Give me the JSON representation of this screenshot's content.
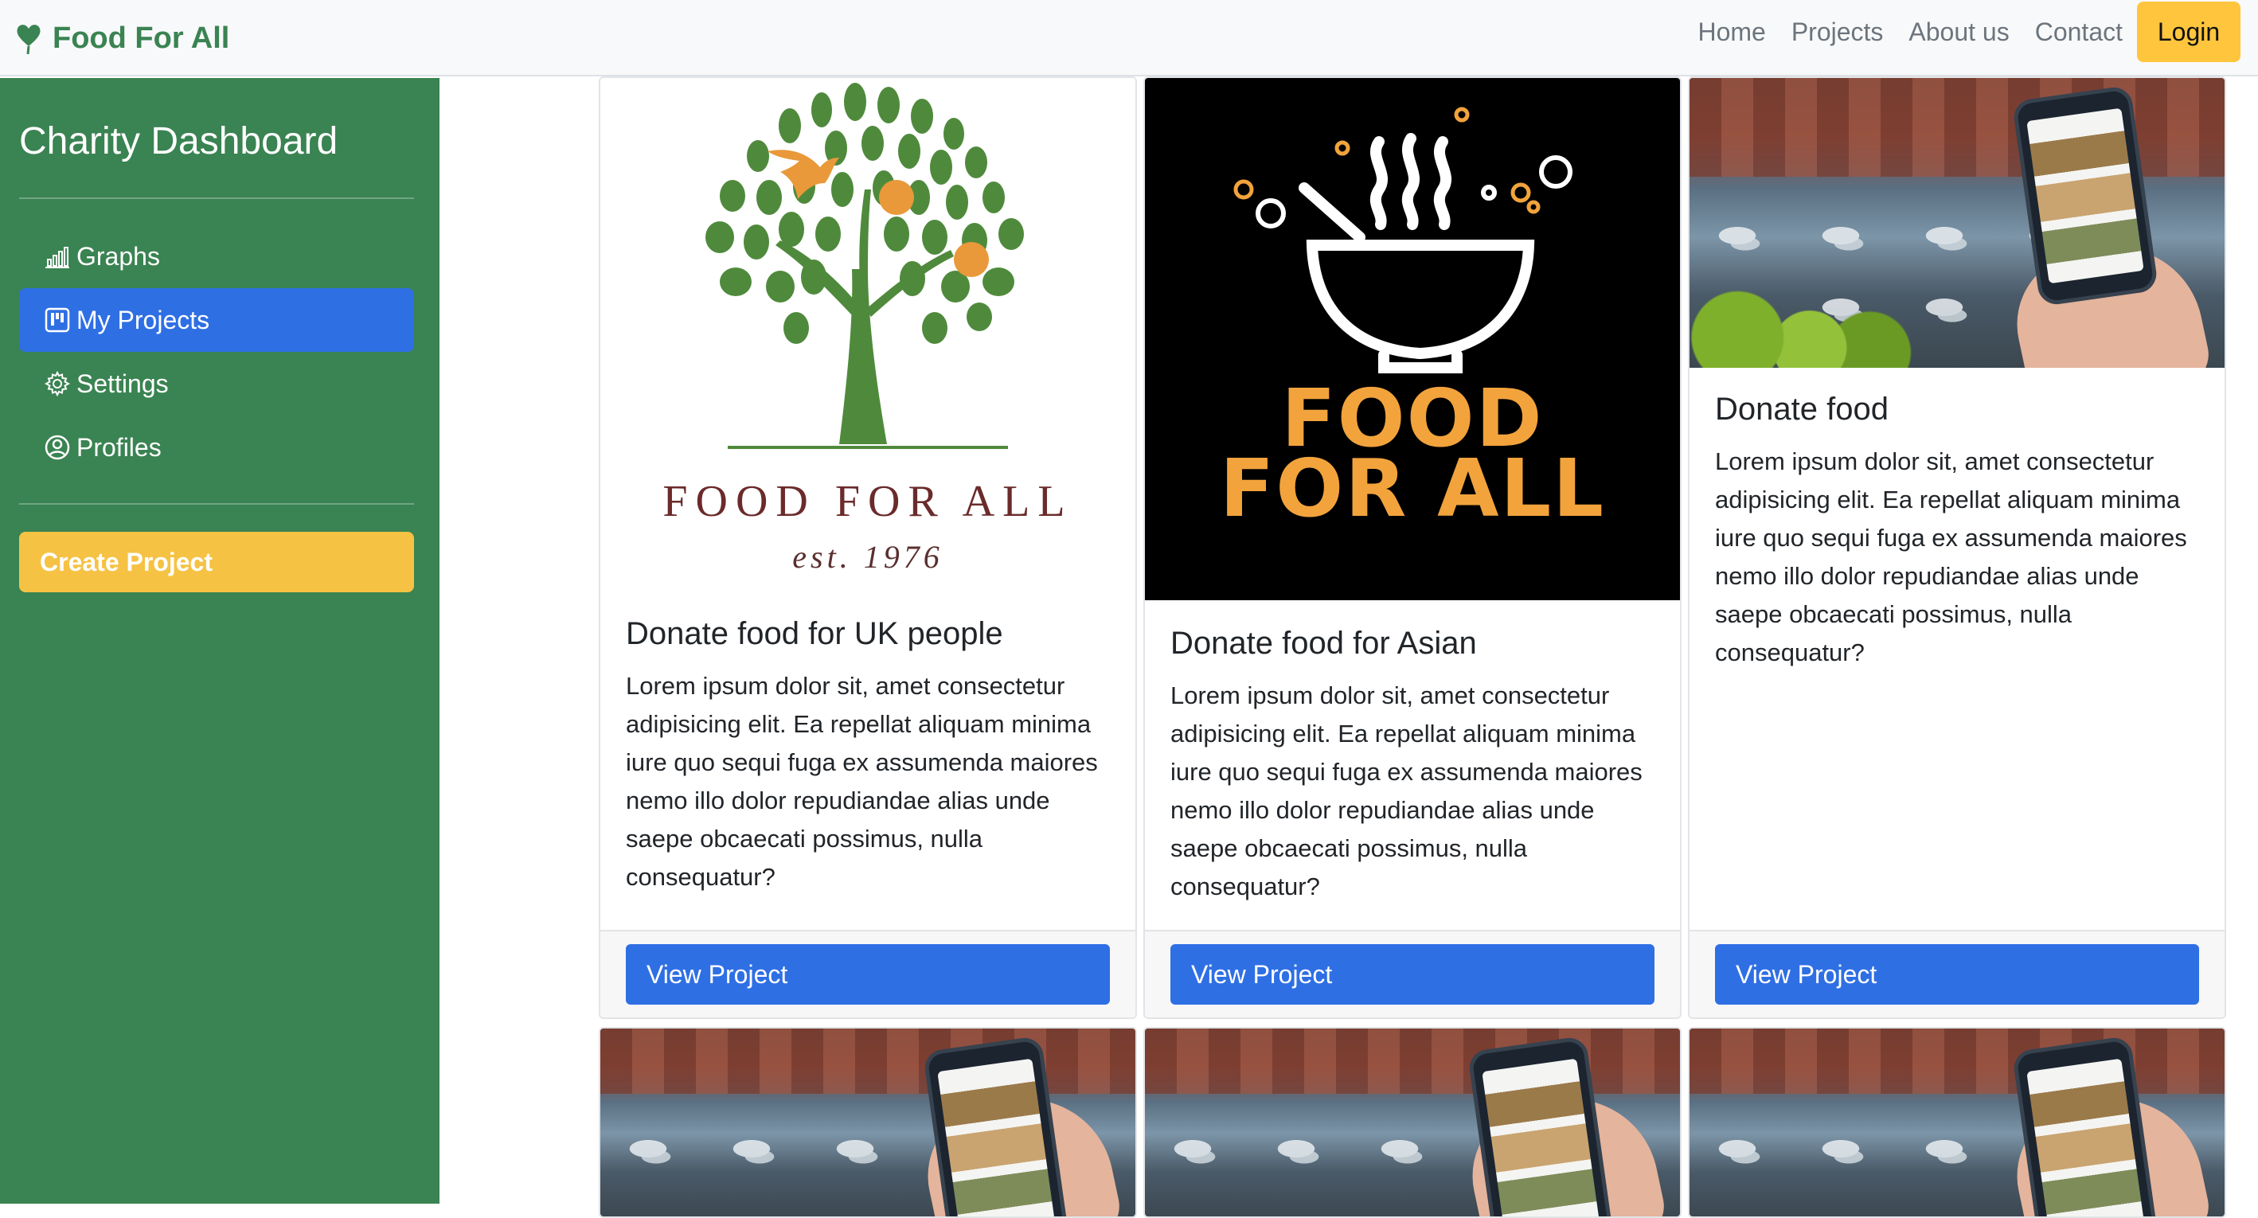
{
  "navbar": {
    "brand": "Food For All",
    "links": [
      "Home",
      "Projects",
      "About us",
      "Contact"
    ],
    "login": "Login"
  },
  "sidebar": {
    "title": "Charity Dashboard",
    "items": [
      {
        "label": "Graphs",
        "icon": "bar-chart-icon"
      },
      {
        "label": "My Projects",
        "icon": "kanban-icon"
      },
      {
        "label": "Settings",
        "icon": "gear-icon"
      },
      {
        "label": "Profiles",
        "icon": "person-circle-icon"
      }
    ],
    "active_item": "My Projects",
    "create_button": "Create Project"
  },
  "logos": {
    "tree": {
      "name": "FOOD FOR ALL",
      "est": "est. 1976"
    },
    "soup": {
      "line1": "FOOD",
      "line2": "FOR ALL"
    }
  },
  "cards": [
    {
      "title": "Donate food for UK people",
      "text": "Lorem ipsum dolor sit, amet consectetur adipisicing elit. Ea repellat aliquam minima iure quo sequi fuga ex assumenda maiores nemo illo dolor repudiandae alias unde saepe obcaecati possimus, nulla consequatur?",
      "button": "View Project"
    },
    {
      "title": "Donate food for Asian",
      "text": "Lorem ipsum dolor sit, amet consectetur adipisicing elit. Ea repellat aliquam minima iure quo sequi fuga ex assumenda maiores nemo illo dolor repudiandae alias unde saepe obcaecati possimus, nulla consequatur?",
      "button": "View Project"
    },
    {
      "title": "Donate food",
      "text": "Lorem ipsum dolor sit, amet consectetur adipisicing elit. Ea repellat aliquam minima iure quo sequi fuga ex assumenda maiores nemo illo dolor repudiandae alias unde saepe obcaecati possimus, nulla consequatur?",
      "button": "View Project"
    }
  ],
  "colors": {
    "brand_green": "#3a8352",
    "primary_blue": "#2f6fe4",
    "warning_yellow": "#ffc53d",
    "logo_orange": "#f2a33c"
  }
}
